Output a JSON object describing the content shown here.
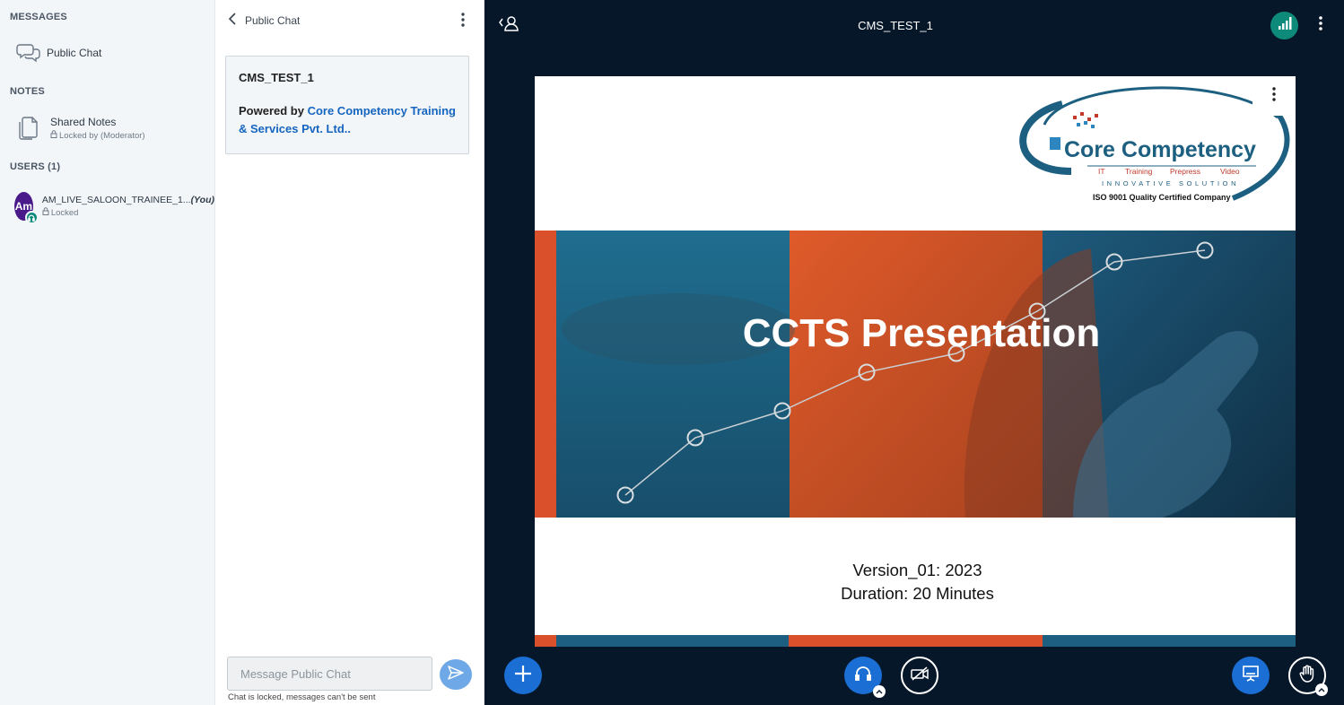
{
  "sidebar": {
    "messages_title": "MESSAGES",
    "public_chat_label": "Public Chat",
    "notes_title": "NOTES",
    "shared_notes_label": "Shared Notes",
    "shared_notes_status": "Locked by (Moderator)",
    "users_title": "USERS (1)",
    "user": {
      "initials": "Am",
      "name": "AM_LIVE_SALOON_TRAINEE_1...",
      "you_tag": "(You)",
      "status": "Locked",
      "avatar_color": "#4a1a8a"
    }
  },
  "chat": {
    "header_title": "Public Chat",
    "welcome_title": "CMS_TEST_1",
    "welcome_prefix": "Powered by ",
    "welcome_link_line1": "Core Competency Training",
    "welcome_link_line2": "& Services Pvt. Ltd..",
    "input_placeholder": "Message Public Chat",
    "locked_note": "Chat is locked, messages can't be sent"
  },
  "main": {
    "meeting_title": "CMS_TEST_1",
    "slide": {
      "logo_name": "Core Competency",
      "logo_tags": [
        "IT",
        "Training",
        "Prepress",
        "Video"
      ],
      "logo_tagline": "INNOVATIVE SOLUTION",
      "logo_iso": "ISO 9001 Quality Certified Company",
      "heading": "CCTS Presentation",
      "version": "Version_01: 2023",
      "duration": "Duration: 20 Minutes"
    }
  },
  "colors": {
    "background": "#06172a",
    "accent_blue": "#1b6ed3",
    "connection_green": "#0e8a7b",
    "slide_teal": "#1d5f80",
    "slide_orange": "#d9502a",
    "link_blue": "#1565c0"
  },
  "icons": {
    "sidebar_chat": "chat-bubbles-icon",
    "sidebar_notes": "document-icon",
    "user_audio": "headset-icon",
    "chat_back": "chevron-left-icon",
    "send": "send-icon",
    "users_toggle": "user-icon",
    "connection": "signal-bars-icon",
    "actions": "plus-icon",
    "audio": "headset-icon",
    "video": "camera-off-icon",
    "presentation": "presentation-screen-icon",
    "raise_hand": "hand-icon"
  }
}
